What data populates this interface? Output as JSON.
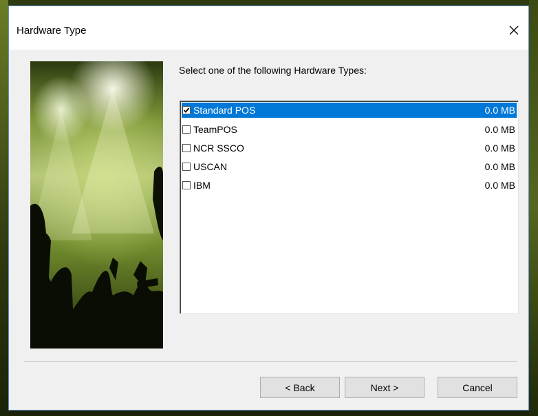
{
  "window": {
    "title": "Hardware Type",
    "close_icon": "close-icon"
  },
  "prompt": "Select one of the following Hardware Types:",
  "hardware_types": [
    {
      "label": "Standard POS",
      "size": "0.0 MB",
      "checked": true,
      "selected": true
    },
    {
      "label": "TeamPOS",
      "size": "0.0 MB",
      "checked": false,
      "selected": false
    },
    {
      "label": "NCR SSCO",
      "size": "0.0 MB",
      "checked": false,
      "selected": false
    },
    {
      "label": "USCAN",
      "size": "0.0 MB",
      "checked": false,
      "selected": false
    },
    {
      "label": "IBM",
      "size": "0.0 MB",
      "checked": false,
      "selected": false
    }
  ],
  "buttons": {
    "back": "< Back",
    "next": "Next >",
    "cancel": "Cancel"
  },
  "colors": {
    "selection": "#0078d7",
    "window_border": "#5a8fd6"
  }
}
